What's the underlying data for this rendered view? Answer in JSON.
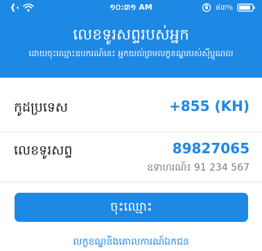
{
  "status_bar": {
    "time": "១០:៣១ AM",
    "battery_text": "៨៣%",
    "icons": [
      "airplane-icon",
      "wifi-icon",
      "rotation-lock-icon",
      "battery-icon"
    ]
  },
  "header": {
    "title": "លេខទូរសព្ទរបស់អ្នក",
    "subtitle": "ដោយចុះឈ្មោះឧបករណ៍នេះ អ្នកយល់ព្រមលក្ខខណ្ឌរបស់ស៊ីប្អូណល"
  },
  "form": {
    "country_code": {
      "label": "កូដប្រទេស",
      "value": "+855 (KH)"
    },
    "phone_number": {
      "label": "លេខទូរសព្ទ",
      "value": "89827065",
      "hint": "ឧទាហរណ៍៖ 91 234 567"
    }
  },
  "actions": {
    "register_label": "ចុះឈ្មោះ",
    "terms_link": "លក្ខខណ្ឌនិងគោលការណ៍ឯកជន"
  },
  "colors": {
    "accent": "#1e88e5",
    "background": "#ffffff",
    "text_primary": "#1a1a1a",
    "text_secondary": "#7b7b7b",
    "divider": "#e5e5e5"
  }
}
